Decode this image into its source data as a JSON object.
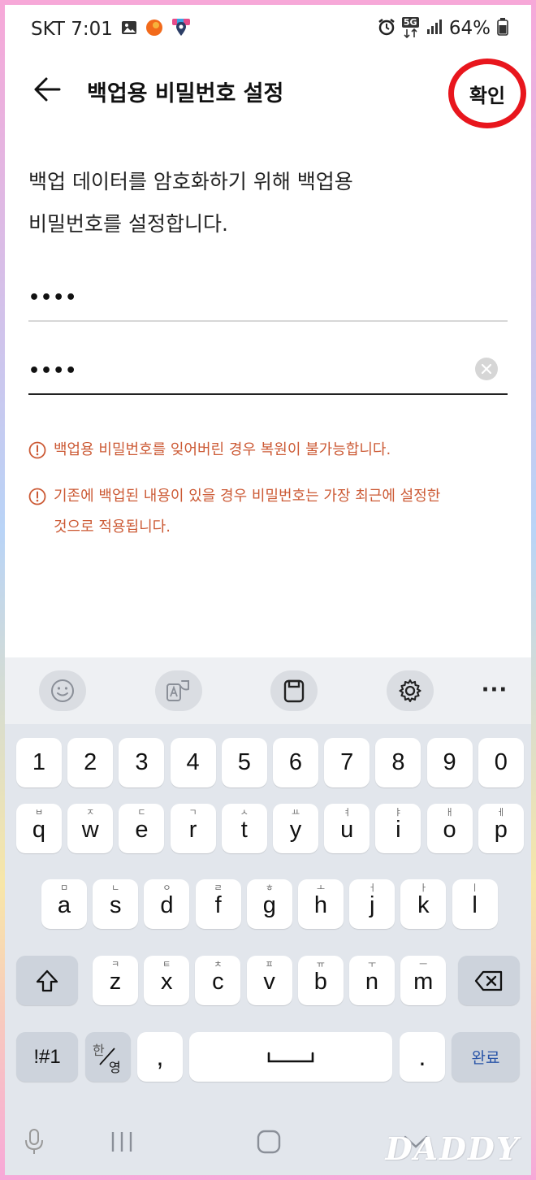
{
  "status_bar": {
    "carrier_time": "SKT 7:01",
    "network": "5G",
    "battery": "64%"
  },
  "header": {
    "title": "백업용 비밀번호 설정",
    "confirm_label": "확인"
  },
  "description": {
    "line1": "백업 데이터를 암호화하기 위해 백업용",
    "line2": "비밀번호를 설정합니다."
  },
  "fields": [
    {
      "value": "••••"
    },
    {
      "value": "••••"
    }
  ],
  "warnings": [
    {
      "text": "백업용 비밀번호를 잊어버린 경우 복원이 불가능합니다."
    },
    {
      "line1": "기존에 백업된 내용이 있을 경우 비밀번호는 가장 최근에 설정한",
      "line2": "것으로 적용됩니다."
    }
  ],
  "keyboard": {
    "toolbar_more": "···",
    "number_row": [
      "1",
      "2",
      "3",
      "4",
      "5",
      "6",
      "7",
      "8",
      "9",
      "0"
    ],
    "row1": [
      {
        "key": "q",
        "hint": "ㅂ"
      },
      {
        "key": "w",
        "hint": "ㅈ"
      },
      {
        "key": "e",
        "hint": "ㄷ"
      },
      {
        "key": "r",
        "hint": "ㄱ"
      },
      {
        "key": "t",
        "hint": "ㅅ"
      },
      {
        "key": "y",
        "hint": "ㅛ"
      },
      {
        "key": "u",
        "hint": "ㅕ"
      },
      {
        "key": "i",
        "hint": "ㅑ"
      },
      {
        "key": "o",
        "hint": "ㅐ"
      },
      {
        "key": "p",
        "hint": "ㅔ"
      }
    ],
    "row2": [
      {
        "key": "a",
        "hint": "ㅁ"
      },
      {
        "key": "s",
        "hint": "ㄴ"
      },
      {
        "key": "d",
        "hint": "ㅇ"
      },
      {
        "key": "f",
        "hint": "ㄹ"
      },
      {
        "key": "g",
        "hint": "ㅎ"
      },
      {
        "key": "h",
        "hint": "ㅗ"
      },
      {
        "key": "j",
        "hint": "ㅓ"
      },
      {
        "key": "k",
        "hint": "ㅏ"
      },
      {
        "key": "l",
        "hint": "ㅣ"
      }
    ],
    "row3": [
      {
        "key": "z",
        "hint": "ㅋ"
      },
      {
        "key": "x",
        "hint": "ㅌ"
      },
      {
        "key": "c",
        "hint": "ㅊ"
      },
      {
        "key": "v",
        "hint": "ㅍ"
      },
      {
        "key": "b",
        "hint": "ㅠ"
      },
      {
        "key": "n",
        "hint": "ㅜ"
      },
      {
        "key": "m",
        "hint": "ㅡ"
      }
    ],
    "symbols_label": "!#1",
    "lang_top": "한",
    "lang_bottom": "영",
    "comma": ",",
    "period": ".",
    "done_label": "완료"
  },
  "watermark": "DADDY",
  "colors": {
    "warning": "#cc5a35",
    "highlight_ring": "#e8161d",
    "keyboard_bg": "#e2e6ec",
    "func_key": "#cdd3dc"
  }
}
